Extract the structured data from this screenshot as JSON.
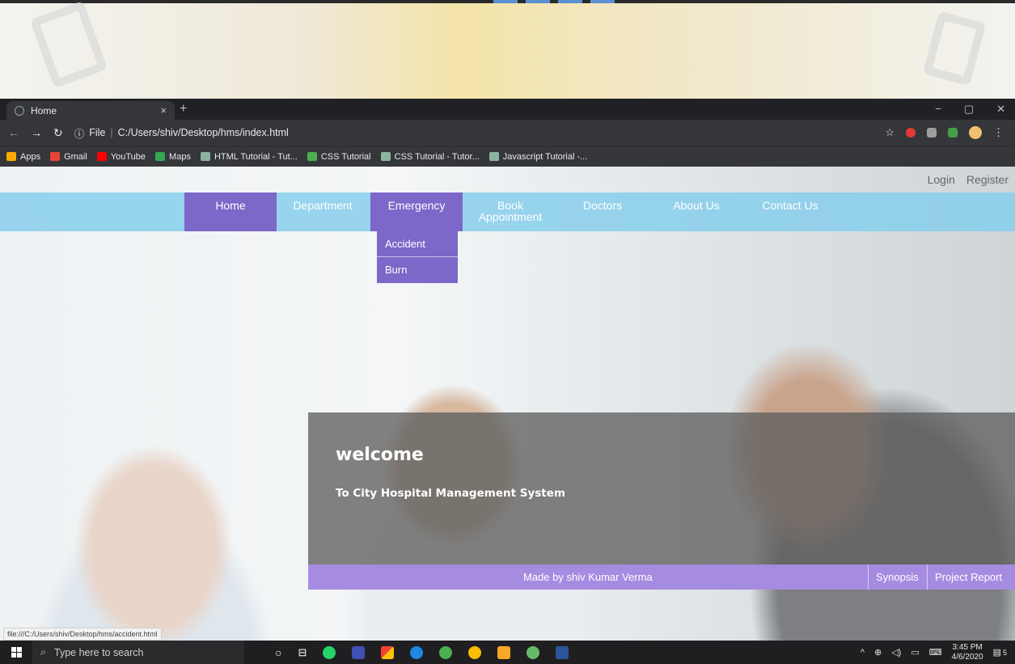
{
  "browser": {
    "tab_title": "Home",
    "tab_close": "×",
    "new_tab": "+",
    "window_controls": [
      "−",
      "▢",
      "✕"
    ],
    "address_prefix": "File",
    "address_url": "C:/Users/shiv/Desktop/hms/index.html",
    "bookmarks": [
      {
        "label": "Apps",
        "color": "#f9ab00"
      },
      {
        "label": "Gmail",
        "color": "#ea4335"
      },
      {
        "label": "YouTube",
        "color": "#ff0000"
      },
      {
        "label": "Maps",
        "color": "#34a853"
      },
      {
        "label": "HTML Tutorial - Tut...",
        "color": "#8ab4a0"
      },
      {
        "label": "CSS Tutorial",
        "color": "#4caf50"
      },
      {
        "label": "CSS Tutorial - Tutor...",
        "color": "#8ab4a0"
      },
      {
        "label": "Javascript Tutorial -...",
        "color": "#8ab4a0"
      }
    ]
  },
  "site": {
    "top_links": {
      "login": "Login",
      "register": "Register"
    },
    "nav": {
      "home": "Home",
      "department": "Department",
      "emergency": "Emergency",
      "book_line1": "Book",
      "book_line2": "Appointment",
      "doctors": "Doctors",
      "about": "About Us",
      "contact": "Contact Us"
    },
    "emergency_menu": {
      "accident": "Accident",
      "burn": "Burn"
    },
    "welcome": {
      "title": "welcome",
      "subtitle": "To City Hospital Management System"
    },
    "footer": {
      "credit": "Made by shiv Kumar Verma",
      "synopsis": "Synopsis",
      "project_report": "Project Report"
    },
    "status_url": "file:///C:/Users/shiv/Desktop/hms/accident.html"
  },
  "taskbar": {
    "search_placeholder": "Type here to search",
    "time": "3:45 PM",
    "date": "4/6/2020",
    "notifications": "5"
  },
  "colors": {
    "nav_bg": "#87ceeb",
    "nav_active": "#7b68c8",
    "footer_bg": "#a58ce0"
  }
}
